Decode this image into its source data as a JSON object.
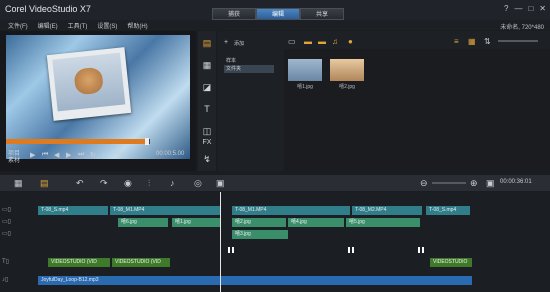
{
  "titlebar": {
    "app_title": "Corel VideoStudio X7"
  },
  "steps": [
    "捕获",
    "编辑",
    "共享"
  ],
  "project_info": "未命名, 720*480",
  "menu": [
    "文件(F)",
    "编辑(E)",
    "工具(T)",
    "设置(S)",
    "帮助(H)"
  ],
  "player": {
    "mode_labels": [
      "项目",
      "素材"
    ],
    "hd": "HD",
    "timecode": "00:00:5.00",
    "progress": 0.98
  },
  "library": {
    "add_label": "添加",
    "tree": [
      "样本",
      "文件夹"
    ],
    "items": [
      {
        "label": "嘻1.jpg"
      },
      {
        "label": "嘻2.jpg"
      }
    ]
  },
  "timeline": {
    "timecode": "00:00:36:01",
    "video_clips": [
      {
        "label": "T-08_S.mp4"
      },
      {
        "label": "T-08_M1.MP4"
      },
      {
        "label": "T-08_M1.MP4"
      },
      {
        "label": "T-08_M2.MP4"
      },
      {
        "label": "T-08_S.mp4"
      }
    ],
    "photo_clips": [
      {
        "label": "嘻6.jpg"
      },
      {
        "label": "嘻1.jpg"
      },
      {
        "label": "嘻2.jpg"
      },
      {
        "label": "嘻4.jpg"
      },
      {
        "label": "嘻5.jpg"
      },
      {
        "label": "嘻3.jpg"
      }
    ],
    "title_clips": [
      {
        "label": "VIDEOSTUDIO (VID"
      },
      {
        "label": "VIDEOSTUDIO (VID"
      },
      {
        "label": "VIDEOSTUDIO"
      }
    ],
    "music_clip": "JoyfulDay_Loop-B12.mp3"
  }
}
